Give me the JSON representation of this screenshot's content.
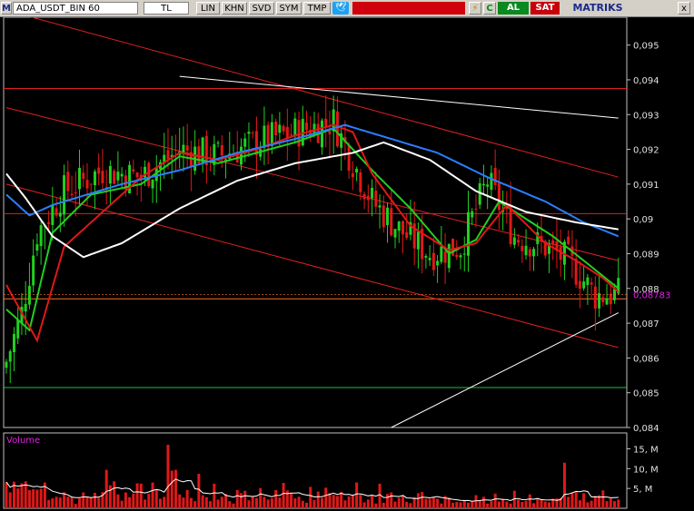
{
  "toolbar": {
    "menu_icon": "M",
    "symbol": "ADA_USDT_BIN   60",
    "currency": "TL",
    "buttons": [
      "LIN",
      "KHN",
      "SVD",
      "SYM",
      "TMP"
    ],
    "bird_icon": "twitter-icon",
    "al_label": "AL",
    "sat_label": "SAT",
    "logo": "MATRIKS",
    "close_label": "x",
    "accent_red": "#d0010c",
    "buy_green": "#0a8a1e",
    "sell_red": "#c8000a"
  },
  "chart_data": {
    "type": "candlestick",
    "background": "#000000",
    "price_axis": {
      "range": [
        0.084,
        0.0958
      ],
      "ticks": [
        "0,095",
        "0,094",
        "0,093",
        "0,092",
        "0,091",
        "0,09",
        "0,089",
        "0,088",
        "0,087",
        "0,086",
        "0,085",
        "0,084"
      ],
      "tick_values": [
        0.095,
        0.094,
        0.093,
        0.092,
        0.091,
        0.09,
        0.089,
        0.088,
        0.087,
        0.086,
        0.085,
        0.084
      ],
      "last_price_label": "0,08783",
      "last_price": 0.08783,
      "label_color": "#e020e0"
    },
    "candle_count": 160,
    "candle_colors": {
      "up": "#20d020",
      "down": "#e01818"
    },
    "close_waypoints": [
      [
        0,
        0.0859
      ],
      [
        4,
        0.0873
      ],
      [
        8,
        0.0896
      ],
      [
        15,
        0.0908
      ],
      [
        25,
        0.0914
      ],
      [
        35,
        0.0912
      ],
      [
        45,
        0.092
      ],
      [
        55,
        0.0918
      ],
      [
        65,
        0.0922
      ],
      [
        75,
        0.0925
      ],
      [
        85,
        0.0928
      ],
      [
        88,
        0.0921
      ],
      [
        95,
        0.0905
      ],
      [
        102,
        0.0897
      ],
      [
        110,
        0.089
      ],
      [
        118,
        0.0892
      ],
      [
        125,
        0.0911
      ],
      [
        132,
        0.0895
      ],
      [
        140,
        0.0892
      ],
      [
        146,
        0.0888
      ],
      [
        153,
        0.0878
      ],
      [
        159,
        0.08783
      ]
    ],
    "moving_averages": [
      {
        "color": "#20d020",
        "points": [
          [
            0,
            0.0874
          ],
          [
            6,
            0.0868
          ],
          [
            12,
            0.0896
          ],
          [
            22,
            0.0907
          ],
          [
            35,
            0.091
          ],
          [
            45,
            0.0918
          ],
          [
            55,
            0.0916
          ],
          [
            65,
            0.0919
          ],
          [
            75,
            0.0922
          ],
          [
            85,
            0.0926
          ],
          [
            95,
            0.0914
          ],
          [
            105,
            0.0903
          ],
          [
            115,
            0.089
          ],
          [
            122,
            0.0894
          ],
          [
            128,
            0.0905
          ],
          [
            135,
            0.09
          ],
          [
            142,
            0.0895
          ],
          [
            150,
            0.0888
          ],
          [
            159,
            0.088
          ]
        ]
      },
      {
        "color": "#e01818",
        "points": [
          [
            0,
            0.0881
          ],
          [
            8,
            0.0865
          ],
          [
            15,
            0.0892
          ],
          [
            35,
            0.0912
          ],
          [
            45,
            0.0919
          ],
          [
            55,
            0.0917
          ],
          [
            65,
            0.092
          ],
          [
            75,
            0.0924
          ],
          [
            85,
            0.0927
          ],
          [
            90,
            0.0925
          ],
          [
            95,
            0.0913
          ],
          [
            105,
            0.0898
          ],
          [
            115,
            0.0891
          ],
          [
            122,
            0.0893
          ],
          [
            130,
            0.0904
          ],
          [
            140,
            0.0893
          ],
          [
            148,
            0.0888
          ],
          [
            155,
            0.0883
          ],
          [
            159,
            0.0879
          ]
        ]
      },
      {
        "color": "#2a7fff",
        "points": [
          [
            0,
            0.0907
          ],
          [
            6,
            0.0901
          ],
          [
            12,
            0.0904
          ],
          [
            30,
            0.091
          ],
          [
            45,
            0.0914
          ],
          [
            60,
            0.0919
          ],
          [
            75,
            0.0923
          ],
          [
            88,
            0.0927
          ],
          [
            100,
            0.0923
          ],
          [
            112,
            0.0919
          ],
          [
            125,
            0.0912
          ],
          [
            140,
            0.0905
          ],
          [
            150,
            0.0899
          ],
          [
            159,
            0.0895
          ]
        ]
      },
      {
        "color": "#ffffff",
        "points": [
          [
            0,
            0.0913
          ],
          [
            5,
            0.0906
          ],
          [
            12,
            0.0895
          ],
          [
            20,
            0.0889
          ],
          [
            30,
            0.0893
          ],
          [
            45,
            0.0903
          ],
          [
            60,
            0.0911
          ],
          [
            75,
            0.0916
          ],
          [
            90,
            0.0919
          ],
          [
            98,
            0.0922
          ],
          [
            110,
            0.0917
          ],
          [
            122,
            0.0908
          ],
          [
            135,
            0.0902
          ],
          [
            148,
            0.0899
          ],
          [
            159,
            0.0897
          ]
        ]
      }
    ],
    "trend_lines": [
      {
        "color": "#e02020",
        "from": [
          0,
          0.096
        ],
        "to": [
          159,
          0.0912
        ]
      },
      {
        "color": "#e02020",
        "from": [
          0,
          0.0932
        ],
        "to": [
          159,
          0.0888
        ]
      },
      {
        "color": "#e02020",
        "from": [
          0,
          0.091
        ],
        "to": [
          159,
          0.0863
        ]
      },
      {
        "color": "#ffffff",
        "from": [
          45,
          0.0941
        ],
        "to": [
          159,
          0.0929
        ]
      },
      {
        "color": "#ffffff",
        "from": [
          100,
          0.084
        ],
        "to": [
          159,
          0.0873
        ]
      }
    ],
    "horizontal_lines": [
      {
        "color": "#e02020",
        "value": 0.09375
      },
      {
        "color": "#e02020",
        "value": 0.09015
      },
      {
        "color": "#ff7020",
        "value": 0.0877
      },
      {
        "color": "#20c040",
        "value": 0.08515
      }
    ],
    "volume_panel": {
      "title": "Volume",
      "title_color": "#e020e0",
      "ticks": [
        "15, M",
        "10, M",
        "5, M"
      ],
      "tick_values": [
        15,
        10,
        5
      ],
      "unit": "M",
      "range": [
        0,
        19
      ],
      "bar_color": "#e01818",
      "average_color": "#ffffff",
      "values": [
        6.6,
        4.0,
        6.7,
        5.0,
        6.3,
        6.8,
        4.6,
        4.8,
        4.7,
        4.9,
        6.5,
        2.1,
        2.5,
        2.9,
        2.7,
        4.0,
        2.9,
        2.8,
        1.1,
        2.5,
        4.0,
        2.8,
        2.8,
        3.9,
        2.6,
        4.1,
        9.7,
        5.8,
        6.8,
        3.5,
        1.9,
        4.0,
        2.8,
        3.7,
        6.3,
        6.2,
        2.2,
        3.7,
        6.5,
        4.6,
        2.4,
        2.9,
        16.0,
        9.5,
        9.7,
        3.5,
        2.7,
        4.6,
        2.6,
        1.8,
        8.7,
        3.3,
        2.8,
        1.8,
        6.2,
        2.2,
        2.9,
        3.6,
        1.8,
        1.2,
        4.6,
        3.8,
        4.4,
        2.0,
        3.0,
        2.6,
        5.1,
        2.9,
        2.2,
        2.5,
        4.6,
        2.7,
        6.4,
        4.5,
        3.8,
        2.5,
        2.9,
        1.9,
        1.4,
        5.4,
        2.1,
        4.2,
        2.6,
        5.2,
        3.8,
        3.4,
        3.1,
        4.1,
        2.0,
        3.0,
        3.4,
        6.5,
        3.4,
        1.5,
        2.2,
        3.2,
        1.2,
        6.2,
        1.4,
        3.6,
        4.0,
        1.7,
        2.6,
        3.3,
        1.6,
        1.3,
        2.8,
        3.8,
        4.1,
        2.4,
        2.4,
        2.7,
        2.4,
        1.2,
        3.1,
        2.7,
        1.4,
        1.6,
        1.5,
        2.1,
        1.4,
        1.8,
        3.3,
        1.9,
        2.9,
        1.2,
        1.8,
        3.7,
        1.7,
        2.4,
        1.7,
        1.2,
        4.4,
        2.2,
        1.6,
        1.9,
        3.5,
        1.3,
        2.4,
        2.3,
        1.7,
        1.5,
        2.4,
        2.5,
        2.6,
        11.5,
        2.9,
        3.8,
        4.1,
        2.0,
        3.8,
        1.5,
        1.9,
        3.1,
        3.3,
        4.5,
        1.8,
        2.5,
        1.8,
        2.2
      ]
    }
  }
}
